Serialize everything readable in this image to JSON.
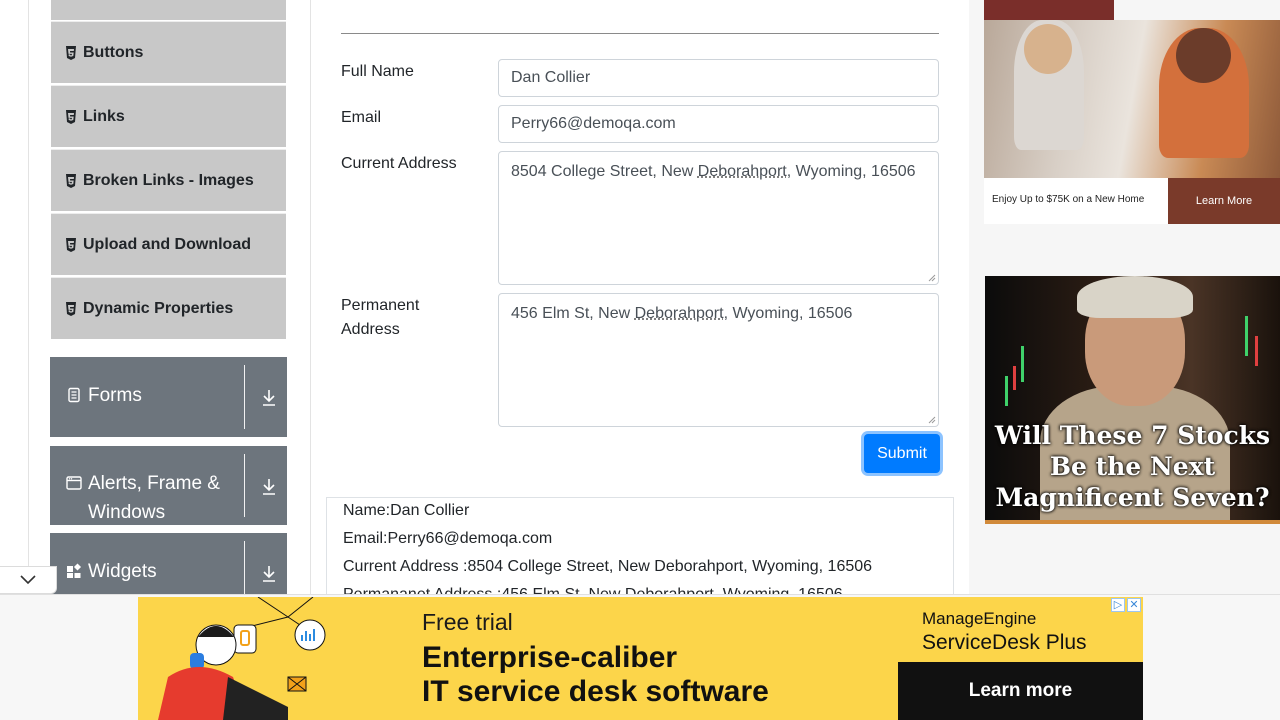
{
  "sidebar": {
    "elements_items": [
      {
        "label": "Buttons"
      },
      {
        "label": "Links"
      },
      {
        "label": "Broken Links - Images"
      },
      {
        "label": "Upload and Download"
      },
      {
        "label": "Dynamic Properties"
      }
    ],
    "groups": [
      {
        "label": "Forms"
      },
      {
        "label": "Alerts, Frame &",
        "label_line2": "Windows"
      },
      {
        "label": "Widgets"
      }
    ]
  },
  "form": {
    "full_name_label": "Full Name",
    "full_name_value": "Dan Collier",
    "email_label": "Email",
    "email_value": "Perry66@demoqa.com",
    "current_address_label": "Current Address",
    "current_address_pre": "8504 College Street, New ",
    "current_address_mid": "Deborahport",
    "current_address_post": ", Wyoming, 16506",
    "permanent_address_label_1": "Permanent",
    "permanent_address_label_2": "Address",
    "permanent_address_pre": "456 Elm St, New ",
    "permanent_address_mid": "Deborahport",
    "permanent_address_post": ", Wyoming, 16506",
    "submit_label": "Submit"
  },
  "output": {
    "name": "Name:Dan Collier",
    "email": "Email:Perry66@demoqa.com",
    "current_address": "Current Address :8504 College Street, New Deborahport, Wyoming, 16506",
    "permanent_address": "Permananet Address :456 Elm St, New Deborahport, Wyoming, 16506"
  },
  "ads": {
    "right_top": {
      "caption": "Enjoy Up to $75K on a New Home",
      "cta": "Learn More"
    },
    "right_bottom": {
      "headline_1": "Will These 7 Stocks",
      "headline_2": "Be the Next",
      "headline_3": "Magnificent Seven?"
    },
    "bottom": {
      "kicker": "Free trial",
      "headline_1": "Enterprise-caliber",
      "headline_2": "IT service desk software",
      "brand_1": "ManageEngine",
      "brand_2": "ServiceDesk Plus",
      "cta": "Learn more"
    }
  },
  "colors": {
    "primary": "#007bff",
    "sidebar_item_bg": "#c8c8c8",
    "group_bg": "#6d757d",
    "bottom_ad_bg": "#fcd54a"
  }
}
